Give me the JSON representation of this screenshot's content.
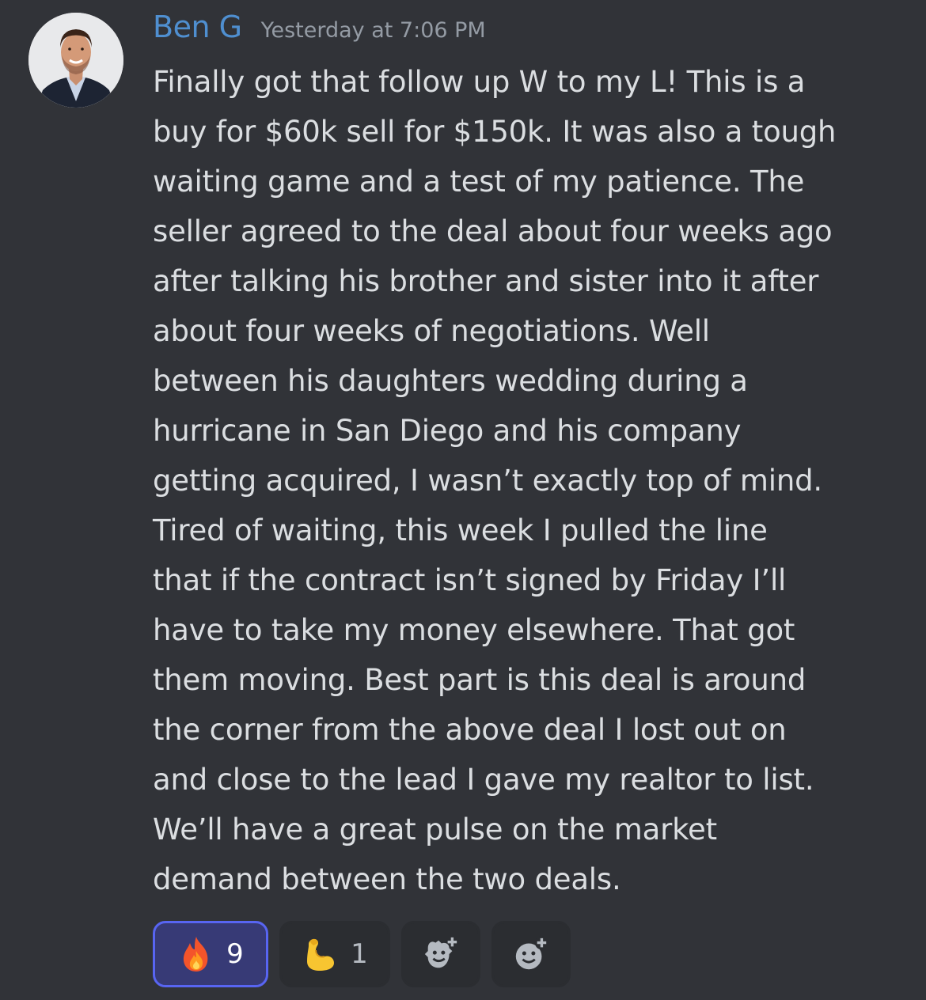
{
  "message": {
    "author": "Ben G",
    "timestamp": "Yesterday at 7:06 PM",
    "lines": [
      "Finally got that follow up W to my L! This is a",
      "buy for $60k sell for $150k. It was also a tough",
      "waiting game and a test of my patience. The",
      "seller agreed to the deal about four weeks ago",
      "after talking his brother and sister into it after",
      "about four weeks of negotiations. Well",
      "between his daughters wedding during a",
      "hurricane in San Diego and his company",
      "getting acquired, I wasn’t exactly top of mind.",
      "Tired of waiting, this week I pulled the line",
      "that if the contract isn’t signed by Friday I’ll",
      "have to take my money elsewhere. That got",
      "them moving. Best part is this deal is around",
      "the corner from the above deal I lost out on",
      "and close to the lead I gave my realtor to list.",
      "We’ll have a great pulse on the market",
      "demand between the two deals."
    ]
  },
  "reactions": [
    {
      "emoji": "fire-icon",
      "count": "9",
      "active": true
    },
    {
      "emoji": "flexed-biceps-icon",
      "count": "1",
      "active": false
    }
  ],
  "colors": {
    "background": "#313338",
    "username": "#4f8fd0",
    "timestamp": "#949ba4",
    "text": "#dbdee1",
    "reaction_bg": "#2b2d31",
    "reaction_active_bg": "#373a76",
    "reaction_active_border": "#5865f2"
  }
}
